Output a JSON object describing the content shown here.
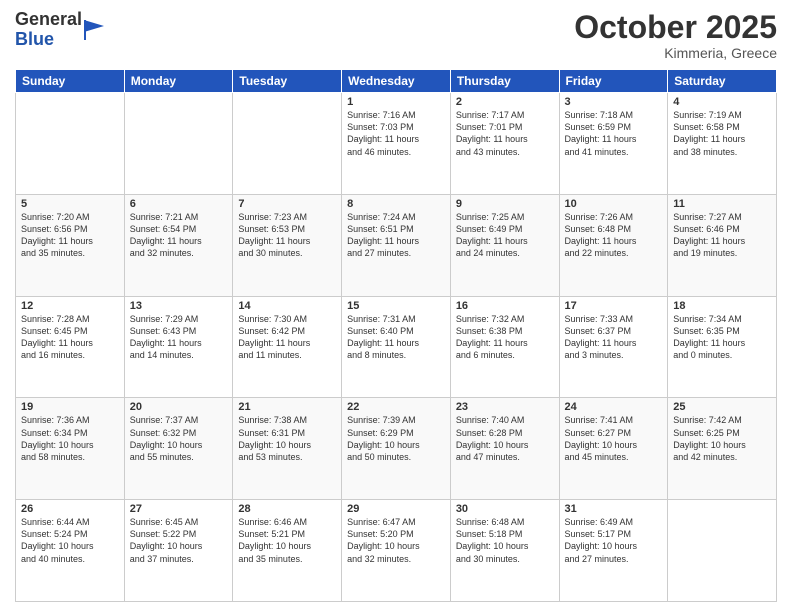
{
  "header": {
    "logo": {
      "general": "General",
      "blue": "Blue"
    },
    "title": "October 2025",
    "subtitle": "Kimmeria, Greece"
  },
  "weekdays": [
    "Sunday",
    "Monday",
    "Tuesday",
    "Wednesday",
    "Thursday",
    "Friday",
    "Saturday"
  ],
  "weeks": [
    [
      {
        "day": "",
        "info": ""
      },
      {
        "day": "",
        "info": ""
      },
      {
        "day": "",
        "info": ""
      },
      {
        "day": "1",
        "info": "Sunrise: 7:16 AM\nSunset: 7:03 PM\nDaylight: 11 hours\nand 46 minutes."
      },
      {
        "day": "2",
        "info": "Sunrise: 7:17 AM\nSunset: 7:01 PM\nDaylight: 11 hours\nand 43 minutes."
      },
      {
        "day": "3",
        "info": "Sunrise: 7:18 AM\nSunset: 6:59 PM\nDaylight: 11 hours\nand 41 minutes."
      },
      {
        "day": "4",
        "info": "Sunrise: 7:19 AM\nSunset: 6:58 PM\nDaylight: 11 hours\nand 38 minutes."
      }
    ],
    [
      {
        "day": "5",
        "info": "Sunrise: 7:20 AM\nSunset: 6:56 PM\nDaylight: 11 hours\nand 35 minutes."
      },
      {
        "day": "6",
        "info": "Sunrise: 7:21 AM\nSunset: 6:54 PM\nDaylight: 11 hours\nand 32 minutes."
      },
      {
        "day": "7",
        "info": "Sunrise: 7:23 AM\nSunset: 6:53 PM\nDaylight: 11 hours\nand 30 minutes."
      },
      {
        "day": "8",
        "info": "Sunrise: 7:24 AM\nSunset: 6:51 PM\nDaylight: 11 hours\nand 27 minutes."
      },
      {
        "day": "9",
        "info": "Sunrise: 7:25 AM\nSunset: 6:49 PM\nDaylight: 11 hours\nand 24 minutes."
      },
      {
        "day": "10",
        "info": "Sunrise: 7:26 AM\nSunset: 6:48 PM\nDaylight: 11 hours\nand 22 minutes."
      },
      {
        "day": "11",
        "info": "Sunrise: 7:27 AM\nSunset: 6:46 PM\nDaylight: 11 hours\nand 19 minutes."
      }
    ],
    [
      {
        "day": "12",
        "info": "Sunrise: 7:28 AM\nSunset: 6:45 PM\nDaylight: 11 hours\nand 16 minutes."
      },
      {
        "day": "13",
        "info": "Sunrise: 7:29 AM\nSunset: 6:43 PM\nDaylight: 11 hours\nand 14 minutes."
      },
      {
        "day": "14",
        "info": "Sunrise: 7:30 AM\nSunset: 6:42 PM\nDaylight: 11 hours\nand 11 minutes."
      },
      {
        "day": "15",
        "info": "Sunrise: 7:31 AM\nSunset: 6:40 PM\nDaylight: 11 hours\nand 8 minutes."
      },
      {
        "day": "16",
        "info": "Sunrise: 7:32 AM\nSunset: 6:38 PM\nDaylight: 11 hours\nand 6 minutes."
      },
      {
        "day": "17",
        "info": "Sunrise: 7:33 AM\nSunset: 6:37 PM\nDaylight: 11 hours\nand 3 minutes."
      },
      {
        "day": "18",
        "info": "Sunrise: 7:34 AM\nSunset: 6:35 PM\nDaylight: 11 hours\nand 0 minutes."
      }
    ],
    [
      {
        "day": "19",
        "info": "Sunrise: 7:36 AM\nSunset: 6:34 PM\nDaylight: 10 hours\nand 58 minutes."
      },
      {
        "day": "20",
        "info": "Sunrise: 7:37 AM\nSunset: 6:32 PM\nDaylight: 10 hours\nand 55 minutes."
      },
      {
        "day": "21",
        "info": "Sunrise: 7:38 AM\nSunset: 6:31 PM\nDaylight: 10 hours\nand 53 minutes."
      },
      {
        "day": "22",
        "info": "Sunrise: 7:39 AM\nSunset: 6:29 PM\nDaylight: 10 hours\nand 50 minutes."
      },
      {
        "day": "23",
        "info": "Sunrise: 7:40 AM\nSunset: 6:28 PM\nDaylight: 10 hours\nand 47 minutes."
      },
      {
        "day": "24",
        "info": "Sunrise: 7:41 AM\nSunset: 6:27 PM\nDaylight: 10 hours\nand 45 minutes."
      },
      {
        "day": "25",
        "info": "Sunrise: 7:42 AM\nSunset: 6:25 PM\nDaylight: 10 hours\nand 42 minutes."
      }
    ],
    [
      {
        "day": "26",
        "info": "Sunrise: 6:44 AM\nSunset: 5:24 PM\nDaylight: 10 hours\nand 40 minutes."
      },
      {
        "day": "27",
        "info": "Sunrise: 6:45 AM\nSunset: 5:22 PM\nDaylight: 10 hours\nand 37 minutes."
      },
      {
        "day": "28",
        "info": "Sunrise: 6:46 AM\nSunset: 5:21 PM\nDaylight: 10 hours\nand 35 minutes."
      },
      {
        "day": "29",
        "info": "Sunrise: 6:47 AM\nSunset: 5:20 PM\nDaylight: 10 hours\nand 32 minutes."
      },
      {
        "day": "30",
        "info": "Sunrise: 6:48 AM\nSunset: 5:18 PM\nDaylight: 10 hours\nand 30 minutes."
      },
      {
        "day": "31",
        "info": "Sunrise: 6:49 AM\nSunset: 5:17 PM\nDaylight: 10 hours\nand 27 minutes."
      },
      {
        "day": "",
        "info": ""
      }
    ]
  ]
}
